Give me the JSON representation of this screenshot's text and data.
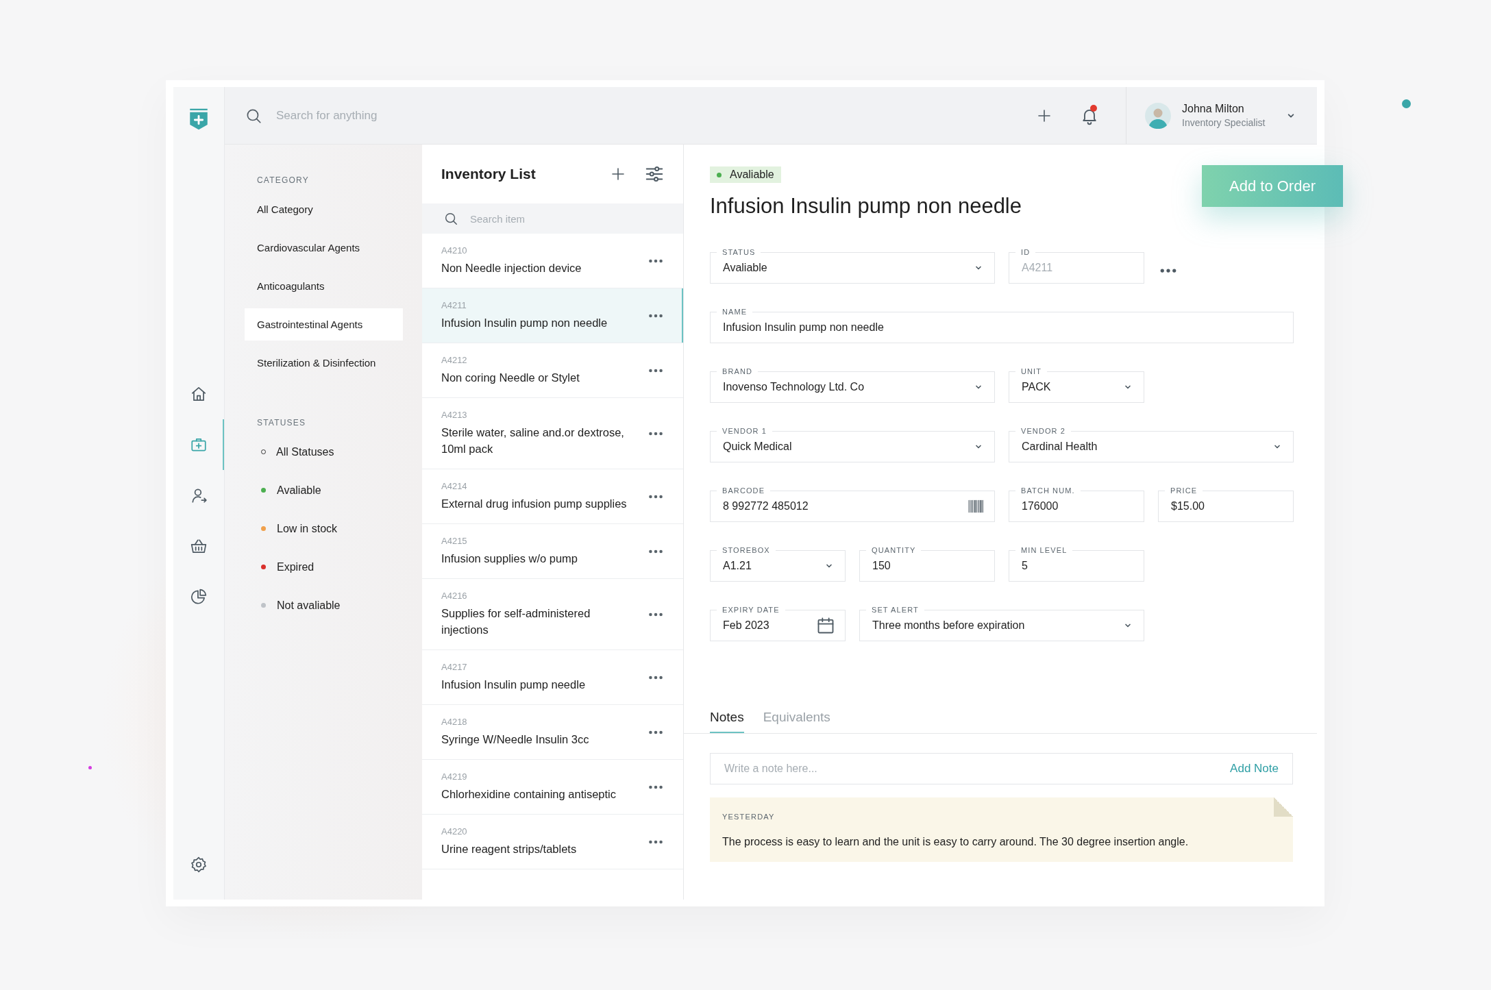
{
  "topbar": {
    "search": {
      "placeholder": "Search for anything"
    },
    "notifications": {
      "unread": true
    },
    "user": {
      "name": "Johna Milton",
      "role": "Inventory Specialist"
    }
  },
  "nav": [
    {
      "kind": "home",
      "selected": false
    },
    {
      "kind": "kit",
      "selected": true
    },
    {
      "kind": "user",
      "selected": false
    },
    {
      "kind": "basket",
      "selected": false
    },
    {
      "kind": "chart",
      "selected": false
    }
  ],
  "sidebar": {
    "sections": [
      {
        "heading": "CATEGORY",
        "items": [
          {
            "label": "All Category",
            "selected": false,
            "kind": "plain"
          },
          {
            "label": "Cardiovascular Agents",
            "selected": false,
            "kind": "plain"
          },
          {
            "label": "Anticoagulants",
            "selected": false,
            "kind": "plain"
          },
          {
            "label": "Gastrointestinal Agents",
            "selected": true,
            "kind": "plain"
          },
          {
            "label": "Sterilization & Disinfection",
            "selected": false,
            "kind": "plain"
          }
        ]
      },
      {
        "heading": "STATUSES",
        "items": [
          {
            "label": "All Statuses",
            "selected": false,
            "kind": "ring"
          },
          {
            "label": "Avaliable",
            "selected": false,
            "kind": "dot",
            "color": "#4caf50"
          },
          {
            "label": "Low in stock",
            "selected": false,
            "kind": "dot",
            "color": "#f0a04b"
          },
          {
            "label": "Expired",
            "selected": false,
            "kind": "dot",
            "color": "#d9302b"
          },
          {
            "label": "Not avaliable",
            "selected": false,
            "kind": "dot",
            "color": "#bfc3c8"
          }
        ]
      }
    ]
  },
  "inventory": {
    "title": "Inventory List",
    "search": {
      "placeholder": "Search item"
    },
    "items": [
      {
        "id": "A4210",
        "name": "Non Needle injection device",
        "selected": false
      },
      {
        "id": "A4211",
        "name": "Infusion Insulin pump non needle",
        "selected": true
      },
      {
        "id": "A4212",
        "name": "Non coring Needle or Stylet",
        "selected": false
      },
      {
        "id": "A4213",
        "name": "Sterile water, saline and.or dextrose, 10ml pack",
        "selected": false
      },
      {
        "id": "A4214",
        "name": "External drug infusion pump supplies",
        "selected": false
      },
      {
        "id": "A4215",
        "name": "Infusion supplies w/o pump",
        "selected": false
      },
      {
        "id": "A4216",
        "name": "Supplies for self-administered injections",
        "selected": false
      },
      {
        "id": "A4217",
        "name": "Infusion Insulin pump needle",
        "selected": false
      },
      {
        "id": "A4218",
        "name": "Syringe W/Needle Insulin 3cc",
        "selected": false
      },
      {
        "id": "A4219",
        "name": "Chlorhexidine containing antiseptic",
        "selected": false
      },
      {
        "id": "A4220",
        "name": "Urine reagent strips/tablets",
        "selected": false
      }
    ]
  },
  "detail": {
    "status_badge": {
      "label": "Avaliable",
      "color": "#4caf50"
    },
    "title": "Infusion Insulin pump non needle",
    "add_button": "Add to Order",
    "fields": [
      {
        "label": "STATUS",
        "value": "Avaliable",
        "kind": "select",
        "disabled": false
      },
      {
        "label": "ID",
        "value": "A4211",
        "kind": "text",
        "disabled": true
      },
      {
        "label": "NAME",
        "value": "Infusion Insulin pump non needle",
        "kind": "text",
        "disabled": false
      },
      {
        "label": "BRAND",
        "value": "Inovenso Technology Ltd. Co",
        "kind": "select",
        "disabled": false
      },
      {
        "label": "UNIT",
        "value": "PACK",
        "kind": "select",
        "disabled": false
      },
      {
        "label": "VENDOR 1",
        "value": "Quick Medical",
        "kind": "select",
        "disabled": false
      },
      {
        "label": "VENDOR 2",
        "value": "Cardinal Health",
        "kind": "select",
        "disabled": false
      },
      {
        "label": "BARCODE",
        "value": "8 992772 485012",
        "kind": "barcode",
        "disabled": false
      },
      {
        "label": "BATCH NUM.",
        "value": "176000",
        "kind": "text",
        "disabled": false
      },
      {
        "label": "PRICE",
        "value": "$15.00",
        "kind": "text",
        "disabled": false
      },
      {
        "label": "STOREBOX",
        "value": "A1.21",
        "kind": "select",
        "disabled": false
      },
      {
        "label": "QUANTITY",
        "value": "150",
        "kind": "text",
        "disabled": false
      },
      {
        "label": "MIN LEVEL",
        "value": "5",
        "kind": "text",
        "disabled": false
      },
      {
        "label": "EXPIRY DATE",
        "value": "Feb 2023",
        "kind": "date",
        "disabled": false
      },
      {
        "label": "SET ALERT",
        "value": "Three months before expiration",
        "kind": "select",
        "disabled": false
      }
    ],
    "tabs": [
      {
        "label": "Notes",
        "selected": true
      },
      {
        "label": "Equivalents",
        "selected": false
      }
    ],
    "note_input": {
      "placeholder": "Write a note here...",
      "action": "Add Note"
    },
    "notes": [
      {
        "date": "YESTERDAY",
        "text": "The process is easy to learn and the unit is easy to carry around. The 30 degree insertion angle."
      }
    ]
  }
}
